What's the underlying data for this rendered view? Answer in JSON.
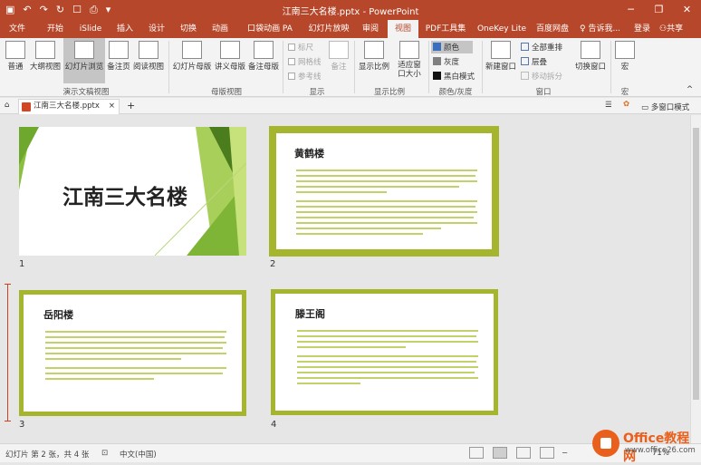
{
  "window": {
    "title": "江南三大名楼.pptx - PowerPoint",
    "controls": [
      "─",
      "❐",
      "✕"
    ],
    "qat_icons": [
      "save-icon",
      "undo-icon",
      "redo-icon",
      "refresh-icon",
      "open-icon",
      "print-icon",
      "more-icon"
    ],
    "qat_glyphs": [
      "▣",
      "↶",
      "↷",
      "↻",
      "☐",
      "⎙",
      "▾"
    ]
  },
  "tabs": [
    "文件",
    "开始",
    "iSlide",
    "插入",
    "设计",
    "切换",
    "动画",
    "口袋动画 PA",
    "幻灯片放映",
    "审阅",
    "视图",
    "PDF工具集",
    "OneKey Lite",
    "百度网盘"
  ],
  "active_tab": "视图",
  "tell_me": "告诉我...",
  "signin": "登录",
  "share": "共享",
  "ribbon": {
    "presentation_views": {
      "label": "演示文稿视图",
      "buttons": [
        "普通",
        "大纲视图",
        "幻灯片浏览",
        "备注页",
        "阅读视图"
      ],
      "selected": "幻灯片浏览"
    },
    "master_views": {
      "label": "母版视图",
      "buttons": [
        "幻灯片母版",
        "讲义母版",
        "备注母版"
      ]
    },
    "show": {
      "label": "显示",
      "checks": [
        "标尺",
        "网格线",
        "参考线"
      ],
      "notes": "备注"
    },
    "zoom": {
      "label": "显示比例",
      "buttons": [
        "显示比例",
        "适应窗口大小"
      ]
    },
    "color": {
      "label": "颜色/灰度",
      "items": [
        "颜色",
        "灰度",
        "黑白模式"
      ],
      "colors": [
        "#3a6fbf",
        "#808080",
        "#111111"
      ]
    },
    "window": {
      "label": "窗口",
      "new_window": "新建窗口",
      "items": [
        "全部重排",
        "层叠",
        "移动拆分"
      ]
    },
    "switch": {
      "label": "切换窗口"
    },
    "macros": {
      "label": "宏",
      "button": "宏"
    }
  },
  "doc_tab": {
    "name": "江南三大名楼.pptx",
    "close": "×",
    "add": "+",
    "multi_window": "多窗口模式"
  },
  "slides": [
    {
      "num": "1",
      "title": "江南三大名楼"
    },
    {
      "num": "2",
      "title": "黄鹤楼"
    },
    {
      "num": "3",
      "title": "岳阳楼"
    },
    {
      "num": "4",
      "title": "滕王阁"
    }
  ],
  "status": {
    "slide_info": "幻灯片 第 2 张，共 4 张",
    "lang": "中文(中国)",
    "zoom": "71%"
  },
  "watermark": {
    "brand": "Office教程网",
    "url": "www.office26.com"
  }
}
